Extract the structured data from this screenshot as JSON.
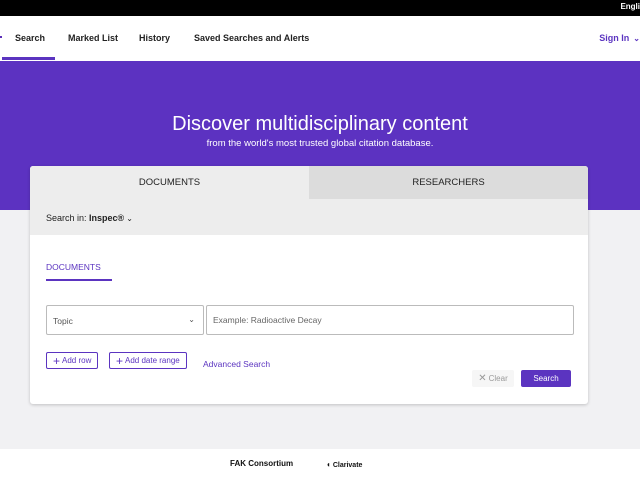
{
  "topbar": {
    "language": "Engli"
  },
  "nav": {
    "items": [
      {
        "label": "Search"
      },
      {
        "label": "Marked List"
      },
      {
        "label": "History"
      },
      {
        "label": "Saved Searches and Alerts"
      }
    ],
    "sign_in": "Sign In"
  },
  "hero": {
    "title": "Discover multidisciplinary content",
    "subtitle": "from the world's most trusted global citation database."
  },
  "card": {
    "tabs": [
      {
        "label": "DOCUMENTS"
      },
      {
        "label": "RESEARCHERS"
      }
    ],
    "search_in_label": "Search in:",
    "search_in_value": "Inspec®",
    "subtab": "DOCUMENTS",
    "field_select_value": "Topic",
    "search_placeholder": "Example: Radioactive Decay",
    "add_row": "Add row",
    "add_date_range": "Add date range",
    "advanced_search": "Advanced Search",
    "clear": "Clear",
    "search": "Search"
  },
  "footer": {
    "consortium": "FAK Consortium",
    "brand": "Clarivate"
  },
  "colors": {
    "accent": "#5b34c0",
    "hero": "#5c32c1"
  }
}
